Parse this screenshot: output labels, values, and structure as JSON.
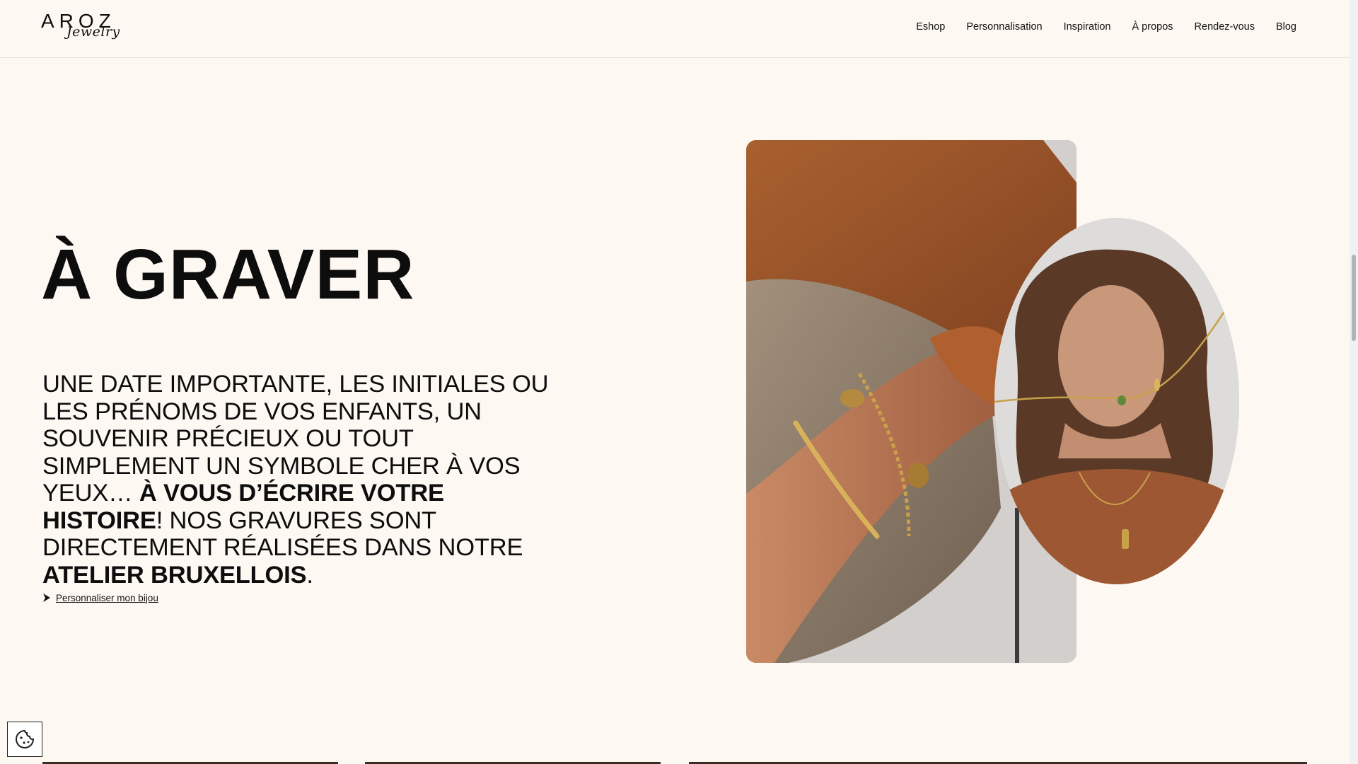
{
  "header": {
    "logo_word": "AROZ",
    "logo_script": "Jewelry",
    "nav": [
      "Eshop",
      "Personnalisation",
      "Inspiration",
      "À propos",
      "Rendez-vous",
      "Blog"
    ]
  },
  "hero": {
    "title": "À GRAVER",
    "desc_part1": "Une date importante, les initiales ou les prénoms de vos enfants, un souvenir précieux ou tout simplement un symbole cher à vos yeux… ",
    "desc_bold1": "À vous d’écrire votre histoire",
    "desc_part2": "! Nos gravures sont directement réalisées dans notre ",
    "desc_bold2": "atelier bruxellois",
    "desc_part3": ".",
    "cta_label": "Personnaliser mon bijou"
  },
  "icons": {
    "cta": "diamond-arrow-icon",
    "cookie": "cookie-icon"
  },
  "colors": {
    "background": "#fef8f3",
    "text": "#0d0d0d"
  }
}
